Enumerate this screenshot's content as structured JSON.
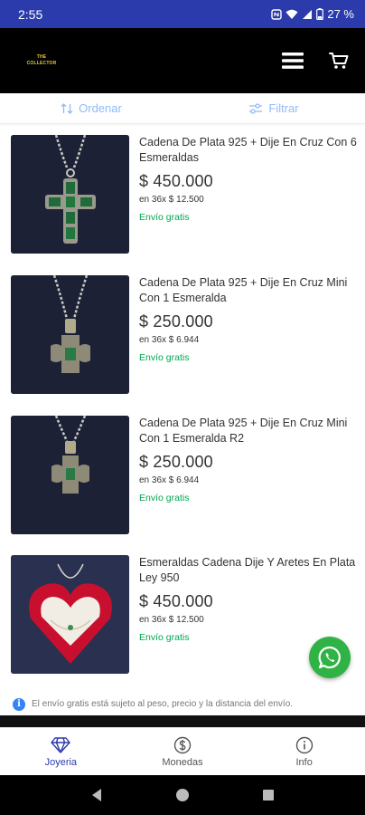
{
  "status_bar": {
    "time": "2:55",
    "battery": "27 %"
  },
  "header": {
    "logo_line1": "THE",
    "logo_line2": "COLLECTOR",
    "menu_icon": "hamburger-icon",
    "cart_icon": "cart-icon"
  },
  "toolbar": {
    "sort_label": "Ordenar",
    "filter_label": "Filtrar"
  },
  "products": [
    {
      "title": "Cadena De Plata 925 + Dije En Cruz Con 6 Esmeraldas",
      "price": "$ 450.000",
      "installments": "en 36x $ 12.500",
      "shipping": "Envío gratis"
    },
    {
      "title": "Cadena De Plata 925 + Dije En Cruz Mini Con 1 Esmeralda",
      "price": "$ 250.000",
      "installments": "en 36x $ 6.944",
      "shipping": "Envío gratis"
    },
    {
      "title": "Cadena De Plata 925 + Dije En Cruz Mini Con 1 Esmeralda R2",
      "price": "$ 250.000",
      "installments": "en 36x $ 6.944",
      "shipping": "Envío gratis"
    },
    {
      "title": "Esmeraldas Cadena Dije Y Aretes En Plata Ley 950",
      "price": "$ 450.000",
      "installments": "en 36x $ 12.500",
      "shipping": "Envío gratis"
    }
  ],
  "notice": {
    "icon": "info-icon",
    "text": "El envío gratis está sujeto al peso, precio y la distancia del envío."
  },
  "tabs": [
    {
      "label": "Joyeria",
      "icon": "diamond-icon",
      "active": true
    },
    {
      "label": "Monedas",
      "icon": "dollar-coin-icon",
      "active": false
    },
    {
      "label": "Info",
      "icon": "info-icon",
      "active": false
    }
  ],
  "colors": {
    "status_bar": "#2b3bab",
    "accent": "#3483fa",
    "shipping_green": "#00a650",
    "whatsapp": "#2fb344"
  }
}
